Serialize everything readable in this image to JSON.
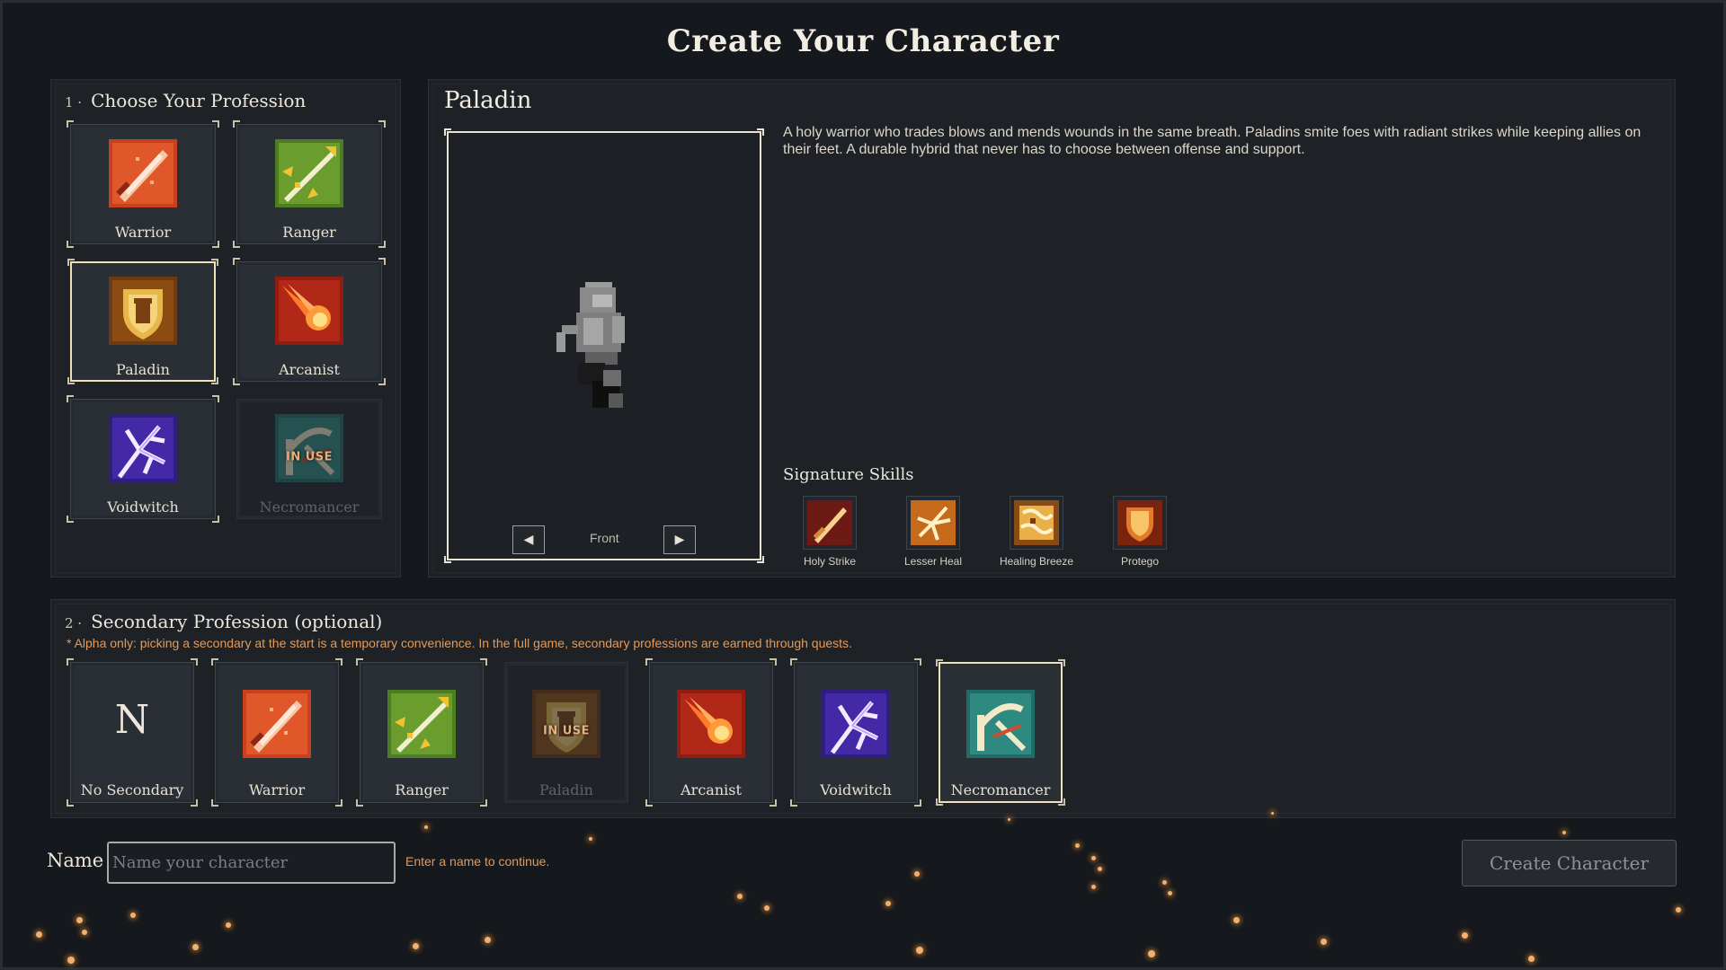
{
  "page_title": "Create Your Character",
  "primary": {
    "step_number": "1 ·",
    "heading": "Choose Your Profession",
    "professions": [
      {
        "label": "Warrior",
        "icon": "warrior-icon"
      },
      {
        "label": "Ranger",
        "icon": "ranger-icon"
      },
      {
        "label": "Paladin",
        "icon": "paladin-icon",
        "selected": true
      },
      {
        "label": "Arcanist",
        "icon": "arcanist-icon"
      },
      {
        "label": "Voidwitch",
        "icon": "voidwitch-icon"
      },
      {
        "label": "Necromancer",
        "icon": "necromancer-icon",
        "disabled": true,
        "badge": "IN USE"
      }
    ]
  },
  "detail": {
    "class_name": "Paladin",
    "description": "A holy warrior who trades blows and mends wounds in the same breath. Paladins smite foes with radiant strikes while keeping allies on their feet. A durable hybrid that never has to choose between offense and support.",
    "view_label": "Front",
    "prev_glyph": "◀",
    "next_glyph": "▶",
    "skills_heading": "Signature Skills",
    "skills": [
      {
        "label": "Holy Strike",
        "icon": "sword-icon"
      },
      {
        "label": "Lesser Heal",
        "icon": "healing-hand-icon"
      },
      {
        "label": "Healing Breeze",
        "icon": "breeze-icon"
      },
      {
        "label": "Protego",
        "icon": "shield-icon"
      }
    ]
  },
  "secondary": {
    "step_number": "2 ·",
    "heading": "Secondary Profession  (optional)",
    "note": "* Alpha only: picking a secondary at the start is a temporary convenience. In the full game, secondary professions are earned through quests.",
    "options": [
      {
        "label": "No Secondary",
        "icon_text": "N"
      },
      {
        "label": "Warrior",
        "icon": "warrior-icon"
      },
      {
        "label": "Ranger",
        "icon": "ranger-icon"
      },
      {
        "label": "Paladin",
        "icon": "paladin-icon",
        "disabled": true,
        "badge": "IN USE"
      },
      {
        "label": "Arcanist",
        "icon": "arcanist-icon"
      },
      {
        "label": "Voidwitch",
        "icon": "voidwitch-icon"
      },
      {
        "label": "Necromancer",
        "icon": "necromancer-icon",
        "selected": true
      }
    ]
  },
  "name_field": {
    "label": "Name",
    "placeholder": "Name your character",
    "value": "",
    "hint": "Enter a name to continue."
  },
  "create_button": {
    "label": "Create Character",
    "enabled": false
  },
  "colors": {
    "background": "#15181c",
    "panel": "#1e2226",
    "accent_gold": "#efe2b8",
    "warning_orange": "#e29a5b"
  }
}
